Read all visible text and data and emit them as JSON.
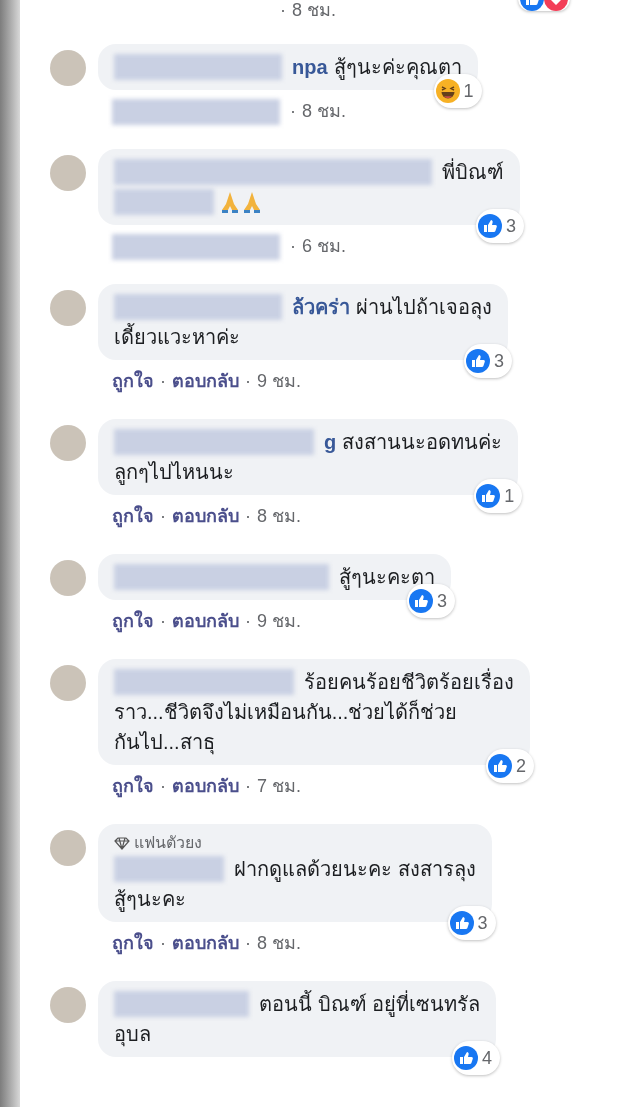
{
  "top_meta": {
    "meta": [
      "·",
      "8 ชม."
    ],
    "reactions": [
      {
        "kind": "like"
      },
      {
        "kind": "love"
      }
    ]
  },
  "comments": [
    {
      "name": "npa",
      "lines": [
        "สู้ๆนะค่ะคุณตา"
      ],
      "reaction": {
        "kind": "haha",
        "count": "1"
      },
      "meta": [
        "·",
        "8 ชม."
      ]
    },
    {
      "lines": [
        "พี่บิณฑ์"
      ],
      "emojis": [
        {
          "kind": "pray"
        },
        {
          "kind": "pray"
        }
      ],
      "reaction": {
        "kind": "like",
        "count": "3"
      },
      "meta": [
        "·",
        "6 ชม."
      ]
    },
    {
      "name": "ล้วคร่า",
      "lines": [
        "ผ่านไปถ้าเจอลุง",
        "เดี้ยวแวะหาค่ะ"
      ],
      "reaction": {
        "kind": "like",
        "count": "3"
      },
      "meta": [
        "ถูกใจ",
        "·",
        "ตอบกลับ",
        "·",
        "9 ชม."
      ]
    },
    {
      "name": "g",
      "lines": [
        "สงสานนะอดทนค่ะ",
        "ลูกๆไปไหนนะ"
      ],
      "reaction": {
        "kind": "like",
        "count": "1"
      },
      "meta": [
        "ถูกใจ",
        "·",
        "ตอบกลับ",
        "·",
        "8 ชม."
      ]
    },
    {
      "lines": [
        "สู้ๆนะคะตา"
      ],
      "reaction": {
        "kind": "like",
        "count": "3"
      },
      "meta": [
        "ถูกใจ",
        "·",
        "ตอบกลับ",
        "·",
        "9 ชม."
      ]
    },
    {
      "lines": [
        "ร้อยคนร้อยชีวิตร้อยเรื่อง",
        "ราว...ชีวิตจึงไม่เหมือนกัน...ช่วยได้ก็ช่วย",
        "กันไป...สาธุ"
      ],
      "reaction": {
        "kind": "like",
        "count": "2"
      },
      "meta": [
        "ถูกใจ",
        "·",
        "ตอบกลับ",
        "·",
        "7 ชม."
      ]
    },
    {
      "badge": "แฟนตัวยง",
      "lines": [
        "ฝากดูแลด้วยนะคะ สงสารลุง",
        "สู้ๆนะคะ"
      ],
      "reaction": {
        "kind": "like",
        "count": "3"
      },
      "meta": [
        "ถูกใจ",
        "·",
        "ตอบกลับ",
        "·",
        "8 ชม."
      ]
    },
    {
      "lines": [
        "ตอนนี้ บิณฑ์ อยู่ที่เซนทรัล",
        "อุบล"
      ],
      "reaction": {
        "kind": "like",
        "count": "4"
      }
    }
  ]
}
